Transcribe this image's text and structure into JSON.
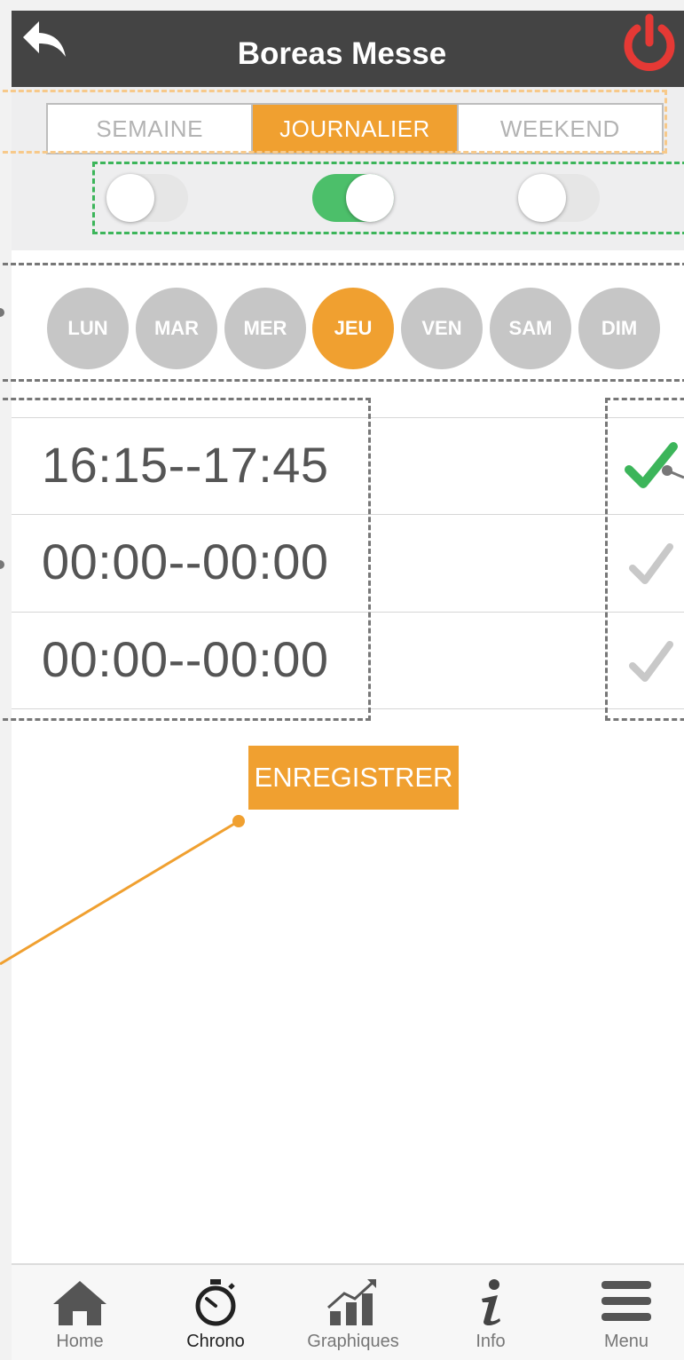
{
  "header": {
    "title": "Boreas Messe",
    "back_icon": "back-arrow-icon",
    "power_icon": "power-icon",
    "power_color": "#e53935"
  },
  "mode_tabs": [
    {
      "label": "SEMAINE",
      "active": false
    },
    {
      "label": "JOURNALIER",
      "active": true
    },
    {
      "label": "WEEKEND",
      "active": false
    }
  ],
  "toggles": [
    {
      "state": "off"
    },
    {
      "state": "on"
    },
    {
      "state": "off"
    }
  ],
  "days": [
    {
      "label": "LUN",
      "active": false
    },
    {
      "label": "MAR",
      "active": false
    },
    {
      "label": "MER",
      "active": false
    },
    {
      "label": "JEU",
      "active": true
    },
    {
      "label": "VEN",
      "active": false
    },
    {
      "label": "SAM",
      "active": false
    },
    {
      "label": "DIM",
      "active": false
    }
  ],
  "time_slots": [
    {
      "range": "16:15--17:45",
      "enabled": true
    },
    {
      "range": "00:00--00:00",
      "enabled": false
    },
    {
      "range": "00:00--00:00",
      "enabled": false
    }
  ],
  "save_label": "ENREGISTRER",
  "nav": [
    {
      "label": "Home",
      "icon": "home-icon",
      "active": false
    },
    {
      "label": "Chrono",
      "icon": "stopwatch-icon",
      "active": true
    },
    {
      "label": "Graphiques",
      "icon": "chart-icon",
      "active": false
    },
    {
      "label": "Info",
      "icon": "info-icon",
      "active": false
    },
    {
      "label": "Menu",
      "icon": "menu-icon",
      "active": false
    }
  ],
  "colors": {
    "accent": "#f0a030",
    "toggle_on": "#4cbf6a",
    "check_on": "#3cb55a",
    "check_off": "#c8c8c8",
    "header_bg": "#444444"
  }
}
